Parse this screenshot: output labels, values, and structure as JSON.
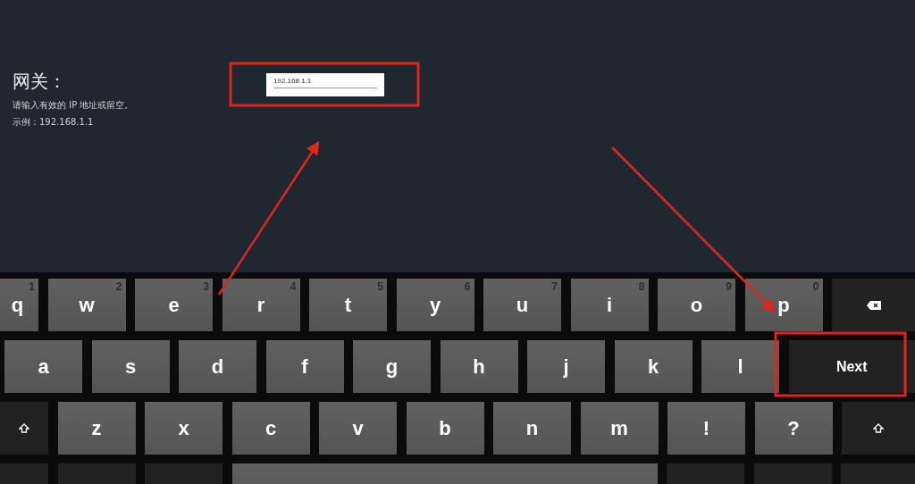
{
  "setting": {
    "title": "网关：",
    "hint": "请输入有效的 IP 地址或留空。",
    "example": "示例：192.168.1.1"
  },
  "field": {
    "value": "192.168.1.1"
  },
  "keyboard": {
    "rows": [
      [
        {
          "kind": "letter",
          "label": "q",
          "hint": "1"
        },
        {
          "kind": "letter",
          "label": "w",
          "hint": "2"
        },
        {
          "kind": "letter",
          "label": "e",
          "hint": "3"
        },
        {
          "kind": "letter",
          "label": "r",
          "hint": "4"
        },
        {
          "kind": "letter",
          "label": "t",
          "hint": "5"
        },
        {
          "kind": "letter",
          "label": "y",
          "hint": "6"
        },
        {
          "kind": "letter",
          "label": "u",
          "hint": "7"
        },
        {
          "kind": "letter",
          "label": "i",
          "hint": "8"
        },
        {
          "kind": "letter",
          "label": "o",
          "hint": "9"
        },
        {
          "kind": "letter",
          "label": "p",
          "hint": "0"
        },
        {
          "kind": "backspace"
        }
      ],
      [
        {
          "kind": "letter",
          "label": "a"
        },
        {
          "kind": "letter",
          "label": "s"
        },
        {
          "kind": "letter",
          "label": "d"
        },
        {
          "kind": "letter",
          "label": "f"
        },
        {
          "kind": "letter",
          "label": "g"
        },
        {
          "kind": "letter",
          "label": "h"
        },
        {
          "kind": "letter",
          "label": "j"
        },
        {
          "kind": "letter",
          "label": "k"
        },
        {
          "kind": "letter",
          "label": "l"
        },
        {
          "kind": "next",
          "label": "Next"
        }
      ],
      [
        {
          "kind": "shift"
        },
        {
          "kind": "letter",
          "label": "z"
        },
        {
          "kind": "letter",
          "label": "x"
        },
        {
          "kind": "letter",
          "label": "c"
        },
        {
          "kind": "letter",
          "label": "v"
        },
        {
          "kind": "letter",
          "label": "b"
        },
        {
          "kind": "letter",
          "label": "n"
        },
        {
          "kind": "letter",
          "label": "m"
        },
        {
          "kind": "letter",
          "label": "!"
        },
        {
          "kind": "letter",
          "label": "?"
        },
        {
          "kind": "shift"
        }
      ],
      [
        {
          "kind": "blank"
        },
        {
          "kind": "blank"
        },
        {
          "kind": "blank"
        },
        {
          "kind": "space"
        },
        {
          "kind": "blank"
        },
        {
          "kind": "blank"
        },
        {
          "kind": "blank"
        }
      ]
    ]
  }
}
